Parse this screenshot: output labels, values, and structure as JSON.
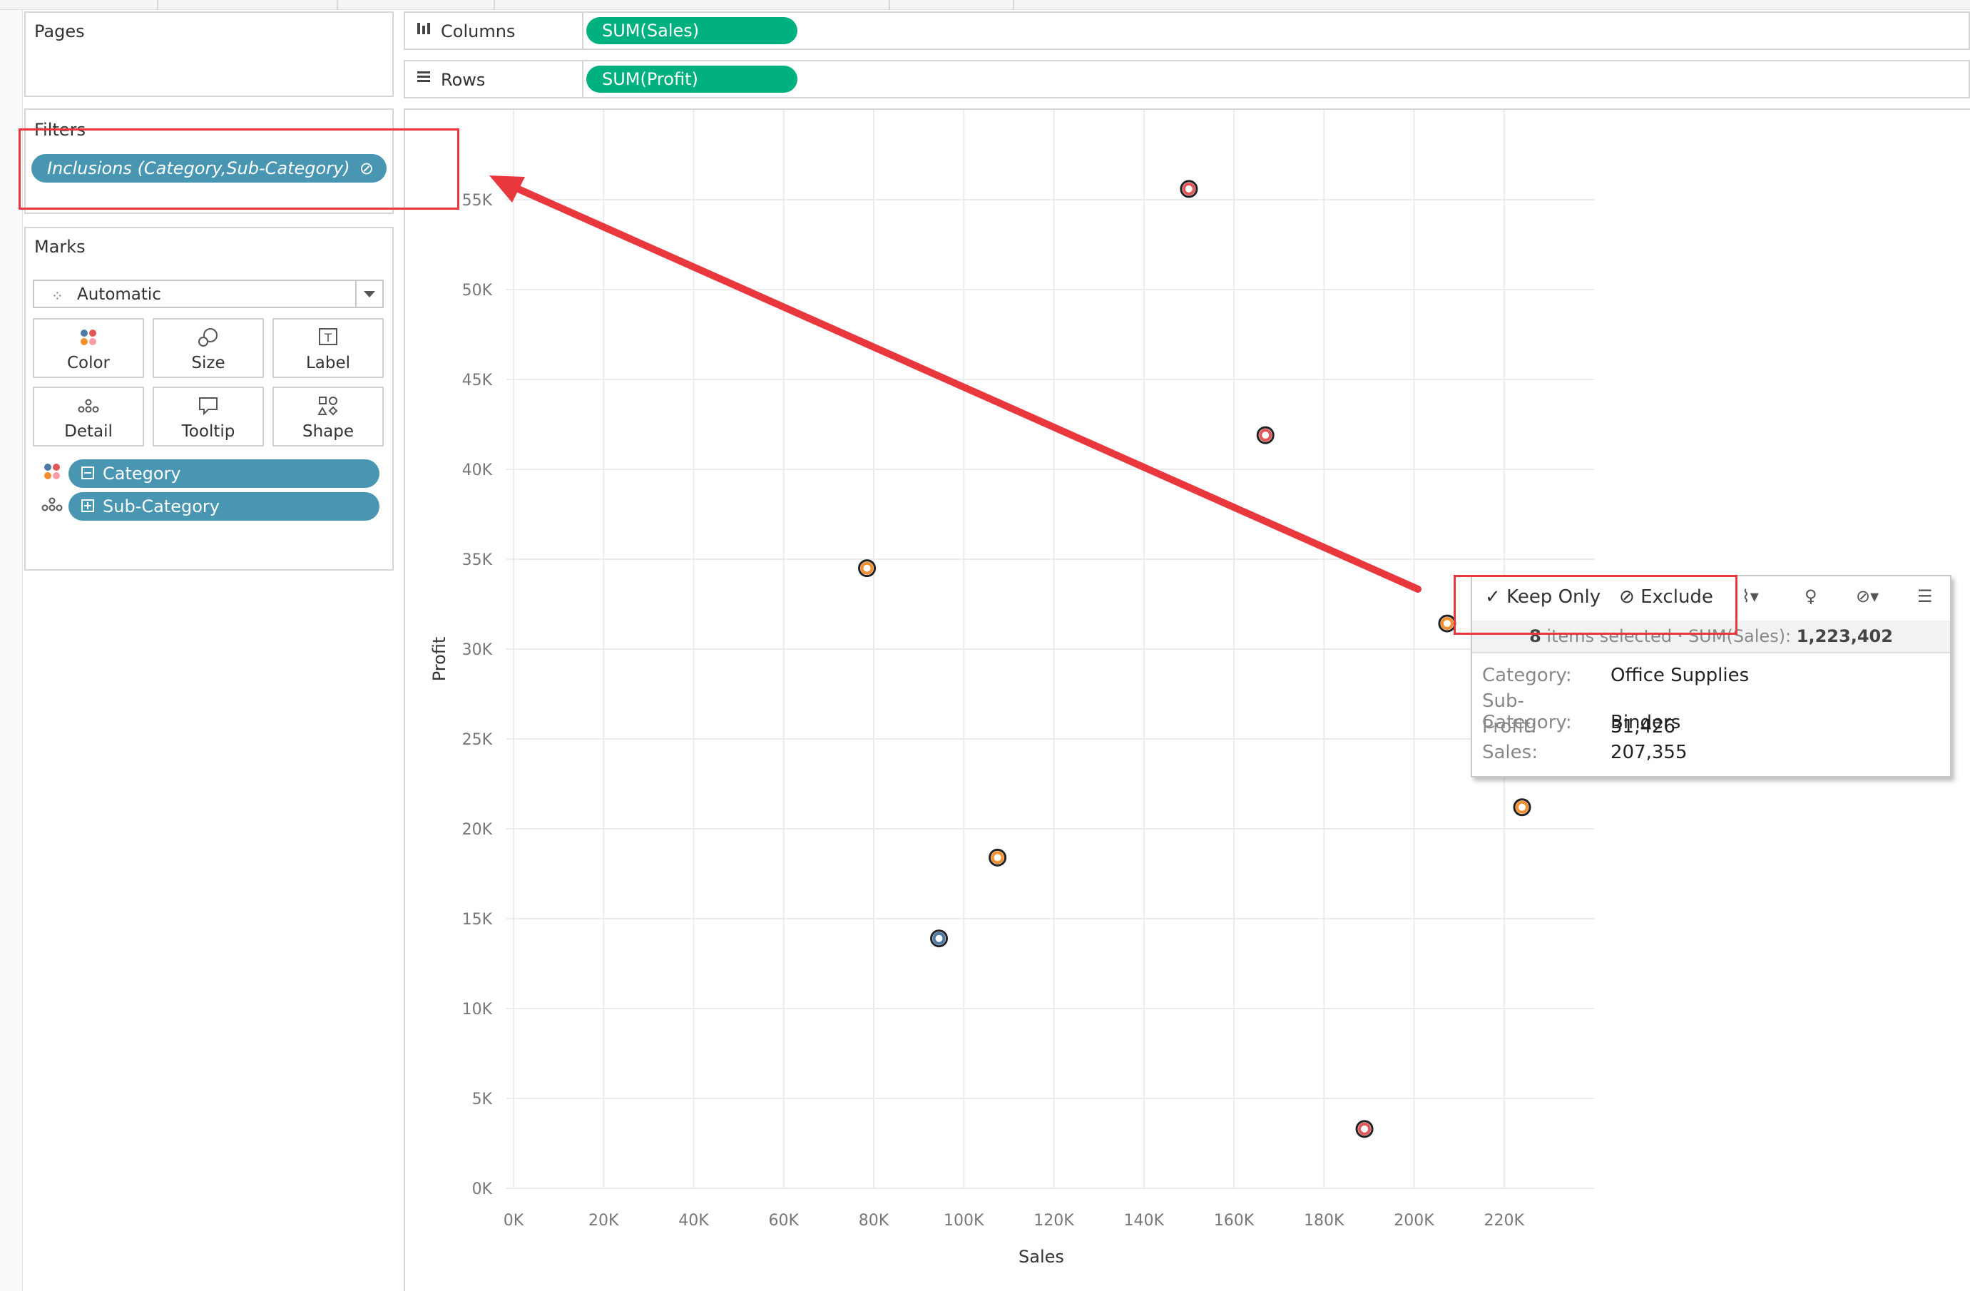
{
  "panels": {
    "pages_title": "Pages",
    "filters_title": "Filters",
    "filter_pill": "Inclusions (Category,Sub-Category)",
    "marks_title": "Marks",
    "mark_type": "Automatic",
    "mark_buttons": [
      "Color",
      "Size",
      "Label",
      "Detail",
      "Tooltip",
      "Shape"
    ],
    "fields": [
      "Category",
      "Sub-Category"
    ]
  },
  "shelves": {
    "columns_label": "Columns",
    "columns_pill": "SUM(Sales)",
    "rows_label": "Rows",
    "rows_pill": "SUM(Profit)"
  },
  "colors": {
    "accent_blue": "#4996b2",
    "accent_green": "#00b180",
    "annotation_red": "#e8383d",
    "cat_orange": "#f28e2b",
    "cat_red": "#e15759",
    "cat_blue": "#4e79a7"
  },
  "chart_data": {
    "type": "scatter",
    "xlabel": "Sales",
    "ylabel": "Profit",
    "xlim": [
      0,
      240000
    ],
    "ylim": [
      0,
      60000
    ],
    "x_ticks": [
      "0K",
      "20K",
      "40K",
      "60K",
      "80K",
      "100K",
      "120K",
      "140K",
      "160K",
      "180K",
      "200K",
      "220K"
    ],
    "y_ticks": [
      "0K",
      "5K",
      "10K",
      "15K",
      "20K",
      "25K",
      "30K",
      "35K",
      "40K",
      "45K",
      "50K",
      "55K"
    ],
    "grid": true,
    "points": [
      {
        "x": 150000,
        "y": 55600,
        "color": "#e15759"
      },
      {
        "x": 167000,
        "y": 41900,
        "color": "#e15759"
      },
      {
        "x": 78500,
        "y": 34500,
        "color": "#f28e2b"
      },
      {
        "x": 207355,
        "y": 31426,
        "color": "#f28e2b"
      },
      {
        "x": 224000,
        "y": 21200,
        "color": "#f28e2b"
      },
      {
        "x": 107500,
        "y": 18400,
        "color": "#f28e2b"
      },
      {
        "x": 94500,
        "y": 13900,
        "color": "#4e79a7"
      },
      {
        "x": 189000,
        "y": 3300,
        "color": "#e15759"
      }
    ]
  },
  "tooltip": {
    "keep_only": "Keep Only",
    "exclude": "Exclude",
    "summary_count": "8",
    "summary_text": " items selected  ·  SUM(Sales): ",
    "summary_value": "1,223,402",
    "rows": [
      {
        "k": "Category:",
        "v": "Office Supplies"
      },
      {
        "k": "Sub-Category:",
        "v": "Binders"
      },
      {
        "k": "Profit:",
        "v": "31,426"
      },
      {
        "k": "Sales:",
        "v": "207,355"
      }
    ]
  }
}
